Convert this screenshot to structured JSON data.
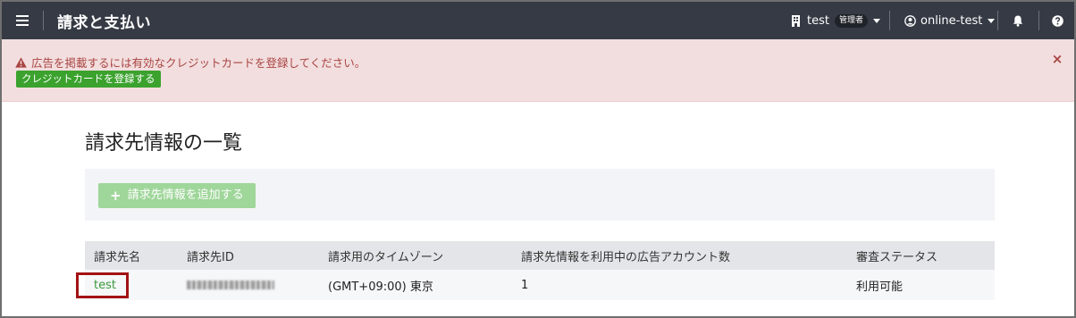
{
  "header": {
    "title": "請求と支払い",
    "account_name": "test",
    "account_role": "管理者",
    "user_name": "online-test"
  },
  "alert": {
    "message": "広告を掲載するには有効なクレジットカードを登録してください。",
    "register_button": "クレジットカードを登録する",
    "close_symbol": "×"
  },
  "main": {
    "page_title": "請求先情報の一覧",
    "add_button_label": "請求先情報を追加する",
    "table": {
      "columns": [
        "請求先名",
        "請求先ID",
        "請求用のタイムゾーン",
        "請求先情報を利用中の広告アカウント数",
        "審査ステータス"
      ],
      "rows": [
        {
          "name": "test",
          "billing_id": "",
          "timezone": "(GMT+09:00) 東京",
          "ad_account_count": "1",
          "review_status": "利用可能"
        }
      ]
    }
  },
  "icons": {
    "menu": "hamburger-icon",
    "building": "building-icon",
    "user": "user-circle-icon",
    "bell": "bell-icon",
    "help": "help-icon",
    "warning": "warning-icon"
  },
  "colors": {
    "topbar": "#353a44",
    "alert_bg": "#f2dede",
    "alert_text": "#a94442",
    "primary_green": "#3ba22e",
    "disabled_green": "#9fd69a",
    "link_green": "#3a9a3a",
    "highlight_red": "#a31212"
  }
}
